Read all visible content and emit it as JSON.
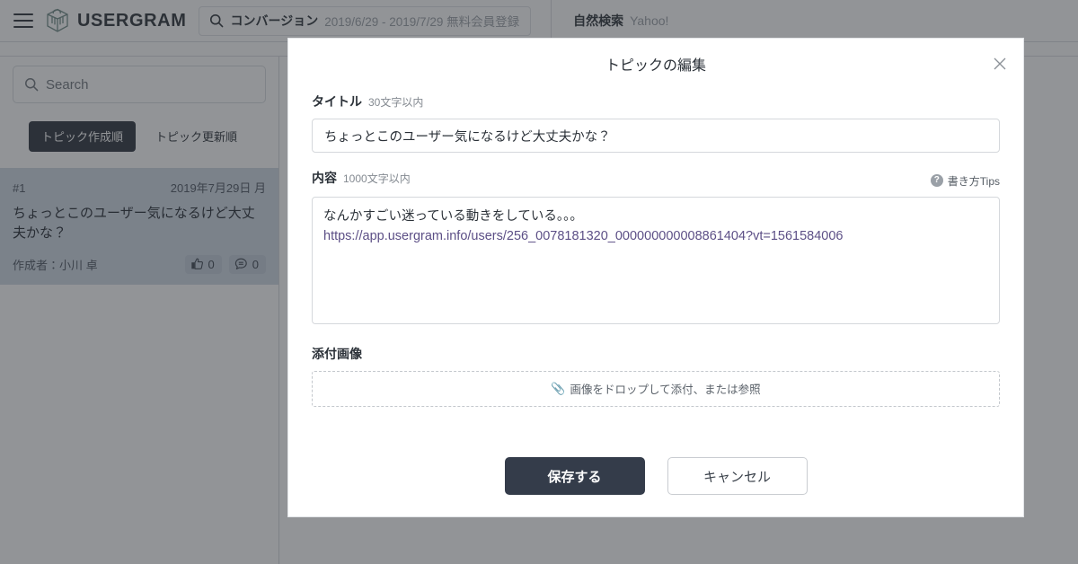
{
  "header": {
    "menu_icon": "hamburger-icon",
    "brand": "USERGRAM",
    "search": {
      "icon": "search-icon",
      "label": "コンバージョン",
      "detail": "2019/6/29 - 2019/7/29 無料会員登録"
    },
    "channel": {
      "label": "自然検索",
      "value": "Yahoo!"
    }
  },
  "sidebar": {
    "search": {
      "icon": "search-icon",
      "placeholder": "Search",
      "value": ""
    },
    "sort_tabs": [
      {
        "label": "トピック作成順",
        "active": true
      },
      {
        "label": "トピック更新順",
        "active": false
      }
    ],
    "topics": [
      {
        "id": "#1",
        "date": "2019年7月29日 月",
        "title": "ちょっとこのユーザー気になるけど大丈夫かな？",
        "author": "作成者：小川 卓",
        "likes": "0",
        "comments": "0",
        "like_icon": "thumbs-up-icon",
        "comment_icon": "comment-icon",
        "selected": true
      }
    ]
  },
  "modal": {
    "title": "トピックの編集",
    "close_icon": "close-icon",
    "title_field": {
      "label": "タイトル",
      "hint": "30文字以内",
      "value": "ちょっとこのユーザー気になるけど大丈夫かな？",
      "placeholder": ""
    },
    "body_field": {
      "label": "内容",
      "hint": "1000文字以内",
      "tips_icon": "help-circle-icon",
      "tips_label": "書き方Tips",
      "value_line_1": "なんかすごい迷っている動きをしている。。。",
      "value_line_2": "https://app.usergram.info/users/256_0078181320_000000000008861404?vt=1561584006",
      "placeholder": ""
    },
    "attachment_field": {
      "label": "添付画像",
      "clip_icon": "paperclip-icon",
      "drop_text": "画像をドロップして添付、または参照"
    },
    "actions": {
      "save": "保存する",
      "cancel": "キャンセル"
    }
  },
  "colors": {
    "primary_button": "#343c4a",
    "active_tab": "#2b313c",
    "selected_card": "#cfd9e4",
    "link_text": "#5c4f86",
    "scrim": "rgba(46,50,56,.52)"
  }
}
